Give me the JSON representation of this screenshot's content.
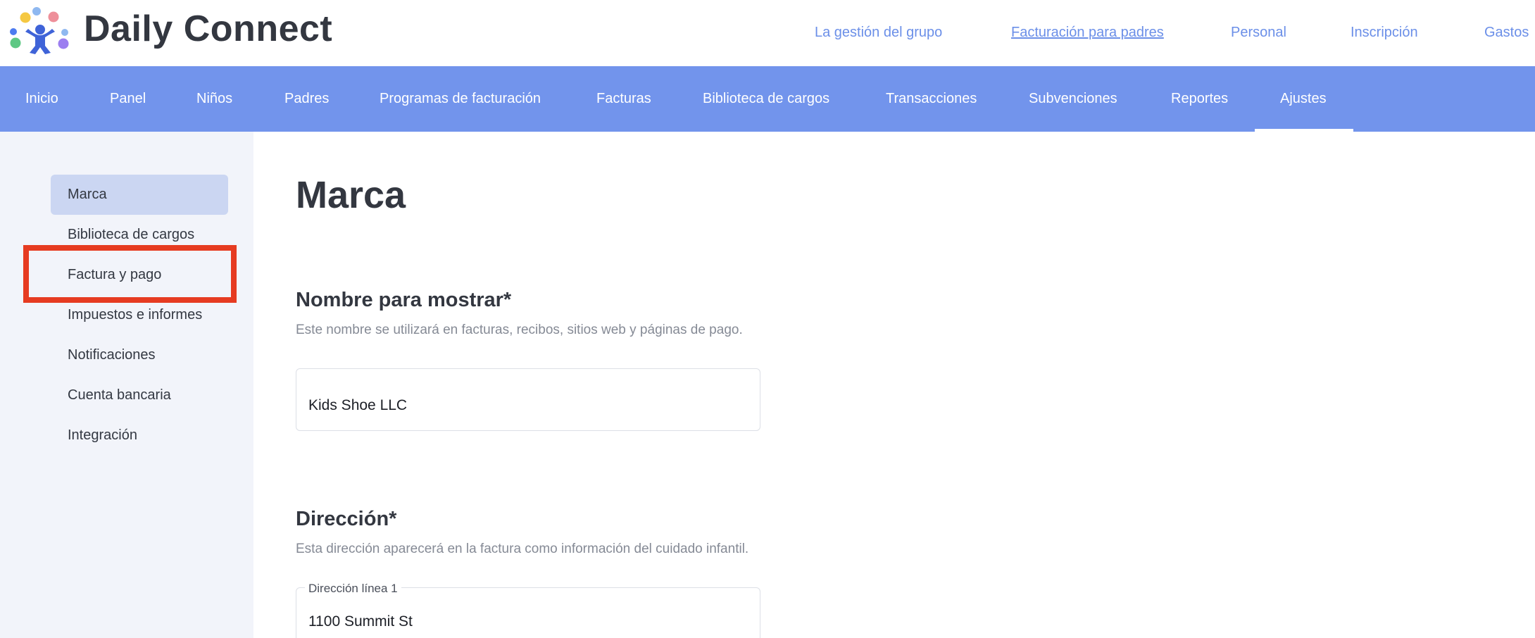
{
  "brand": {
    "name": "Daily Connect",
    "dot_colors": [
      "#f5c842",
      "#ee8f9a",
      "#8fb8f0",
      "#9c7ef0",
      "#5ec884",
      "#4d7bf0"
    ]
  },
  "top_links": [
    {
      "label": "La gestión del grupo"
    },
    {
      "label": "Facturación para padres"
    },
    {
      "label": "Personal"
    },
    {
      "label": "Inscripción"
    },
    {
      "label": "Gastos"
    }
  ],
  "nav": [
    {
      "label": "Inicio"
    },
    {
      "label": "Panel"
    },
    {
      "label": "Niños"
    },
    {
      "label": "Padres"
    },
    {
      "label": "Programas de facturación"
    },
    {
      "label": "Facturas"
    },
    {
      "label": "Biblioteca de cargos"
    },
    {
      "label": "Transacciones"
    },
    {
      "label": "Subvenciones"
    },
    {
      "label": "Reportes"
    },
    {
      "label": "Ajustes"
    }
  ],
  "sidebar": {
    "items": [
      {
        "label": "Marca"
      },
      {
        "label": "Biblioteca de cargos"
      },
      {
        "label": "Factura y pago"
      },
      {
        "label": "Impuestos e informes"
      },
      {
        "label": "Notificaciones"
      },
      {
        "label": "Cuenta bancaria"
      },
      {
        "label": "Integración"
      }
    ]
  },
  "main": {
    "title": "Marca",
    "display_name": {
      "title": "Nombre para mostrar*",
      "description": "Este nombre se utilizará en facturas, recibos, sitios web y páginas de pago.",
      "value": "Kids Shoe LLC"
    },
    "address": {
      "title": "Dirección*",
      "description": "Esta dirección aparecerá en la factura como información del cuidado infantil.",
      "line1_label": "Dirección línea 1",
      "line1_value": "1100 Summit St"
    }
  },
  "colors": {
    "nav_bg": "#7294ec",
    "link": "#6b8fe8",
    "sidebar_bg": "#f2f4fa",
    "sidebar_active": "#cbd6f2",
    "highlight": "#e63b21"
  }
}
